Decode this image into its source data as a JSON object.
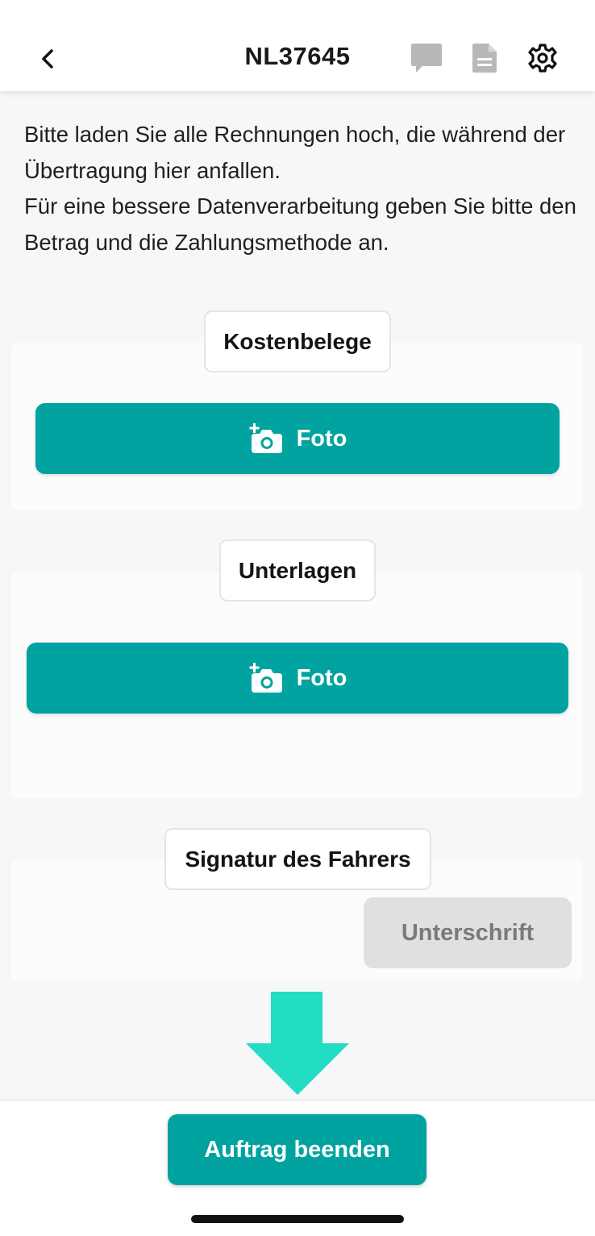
{
  "header": {
    "title": "NL37645",
    "back_icon": "chevron-left-icon",
    "icons": [
      "chat-bubble-icon",
      "document-icon",
      "gear-icon"
    ]
  },
  "intro": {
    "line1": "Bitte laden Sie alle Rechnungen hoch, die während der Übertragung hier anfallen.",
    "line2": "Für eine bessere Datenverarbeitung geben Sie bitte den Betrag und die Zahlungsmethode an."
  },
  "sections": {
    "kostenbelege": {
      "label": "Kostenbelege",
      "button_label": "Foto",
      "button_icon": "add-camera-icon"
    },
    "unterlagen": {
      "label": "Unterlagen",
      "button_label": "Foto",
      "button_icon": "add-camera-icon"
    },
    "signatur": {
      "label": "Signatur des Fahrers",
      "button_label": "Unterschrift"
    }
  },
  "footer": {
    "finish_label": "Auftrag beenden"
  },
  "colors": {
    "primary": "#00a3a0",
    "arrow": "#22dcc3",
    "disabled_button": "#e0e0e0",
    "disabled_text": "#7a7a7a"
  }
}
